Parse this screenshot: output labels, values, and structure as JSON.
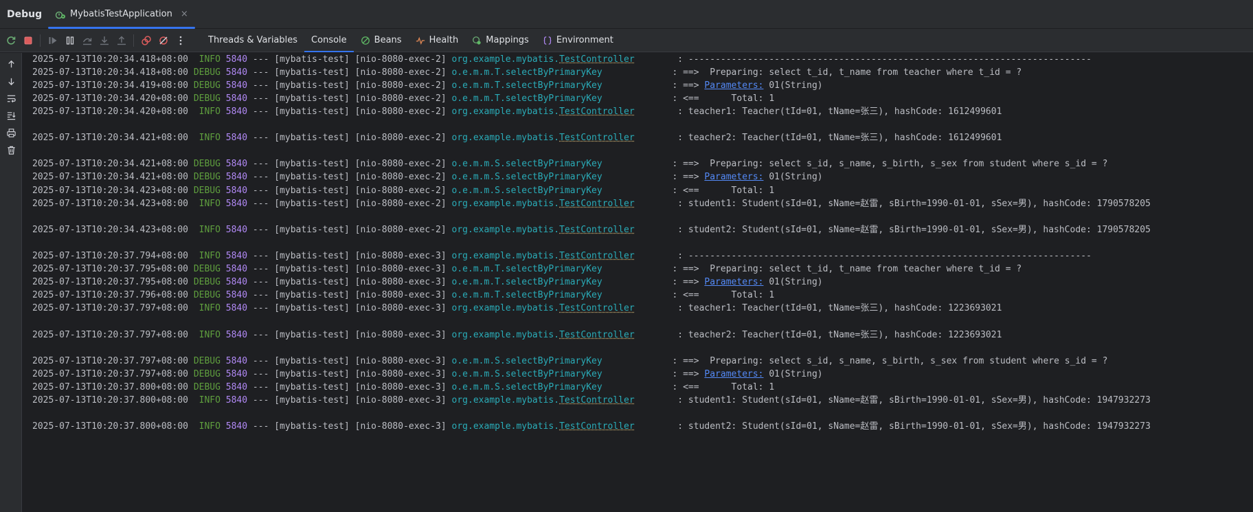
{
  "window": {
    "title": "Debug",
    "run_tab": {
      "label": "MybatisTestApplication",
      "close": "×"
    }
  },
  "toolbar": {
    "buttons": [
      {
        "name": "rerun-icon",
        "color": "#6aab73"
      },
      {
        "name": "stop-icon",
        "color": "#db5c5c"
      },
      {
        "name": "resume-icon",
        "color": "#6f737a"
      },
      {
        "name": "pause-icon",
        "color": "#ced0d6"
      },
      {
        "name": "step-over-icon",
        "color": "#6f737a"
      },
      {
        "name": "step-into-icon",
        "color": "#6f737a"
      },
      {
        "name": "step-out-icon",
        "color": "#6f737a"
      },
      {
        "name": "view-breakpoints-icon",
        "color": "#db5c5c"
      },
      {
        "name": "mute-breakpoints-icon",
        "color": "#db5c5c"
      },
      {
        "name": "more-icon",
        "color": "#ced0d6"
      }
    ],
    "tabs": [
      {
        "label": "Threads & Variables",
        "icon": "",
        "active": false
      },
      {
        "label": "Console",
        "icon": "",
        "active": true
      },
      {
        "label": "Beans",
        "icon": "beans-icon",
        "active": false
      },
      {
        "label": "Health",
        "icon": "health-icon",
        "active": false
      },
      {
        "label": "Mappings",
        "icon": "mappings-icon",
        "active": false
      },
      {
        "label": "Environment",
        "icon": "environment-icon",
        "active": false
      }
    ]
  },
  "sidebar": {
    "buttons": [
      "scroll-up-icon",
      "scroll-down-icon",
      "soft-wrap-icon",
      "scroll-to-end-icon",
      "print-icon",
      "clear-all-icon"
    ]
  },
  "colors": {
    "accent": "#3574f0",
    "level": "#5f9f3e",
    "pid": "#b189f5",
    "logger": "#2aacb8",
    "link": "#548af7"
  },
  "console": {
    "lines": [
      {
        "ts": "2025-07-13T10:20:34.418+08:00",
        "level": " INFO",
        "pid": "5840",
        "sep": "---",
        "app": "[mybatis-test]",
        "thread": "[nio-8080-exec-2]",
        "logger_prefix": "org.example.mybatis.",
        "logger_link": "TestController",
        "logger_plain": "",
        "pad": "       ",
        "msg_pre": ": ---------------------------------------------------------------------------",
        "msg_link": "",
        "msg_post": ""
      },
      {
        "ts": "2025-07-13T10:20:34.418+08:00",
        "level": "DEBUG",
        "pid": "5840",
        "sep": "---",
        "app": "[mybatis-test]",
        "thread": "[nio-8080-exec-2]",
        "logger_prefix": "",
        "logger_link": "",
        "logger_plain": "o.e.m.m.T.selectByPrimaryKey",
        "pad": "            ",
        "msg_pre": ": ==>  Preparing: select t_id, t_name from teacher where t_id = ?",
        "msg_link": "",
        "msg_post": ""
      },
      {
        "ts": "2025-07-13T10:20:34.419+08:00",
        "level": "DEBUG",
        "pid": "5840",
        "sep": "---",
        "app": "[mybatis-test]",
        "thread": "[nio-8080-exec-2]",
        "logger_prefix": "",
        "logger_link": "",
        "logger_plain": "o.e.m.m.T.selectByPrimaryKey",
        "pad": "            ",
        "msg_pre": ": ==> ",
        "msg_link": "Parameters:",
        "msg_post": " 01(String)"
      },
      {
        "ts": "2025-07-13T10:20:34.420+08:00",
        "level": "DEBUG",
        "pid": "5840",
        "sep": "---",
        "app": "[mybatis-test]",
        "thread": "[nio-8080-exec-2]",
        "logger_prefix": "",
        "logger_link": "",
        "logger_plain": "o.e.m.m.T.selectByPrimaryKey",
        "pad": "            ",
        "msg_pre": ": <==      Total: 1",
        "msg_link": "",
        "msg_post": ""
      },
      {
        "ts": "2025-07-13T10:20:34.420+08:00",
        "level": " INFO",
        "pid": "5840",
        "sep": "---",
        "app": "[mybatis-test]",
        "thread": "[nio-8080-exec-2]",
        "logger_prefix": "org.example.mybatis.",
        "logger_link": "TestController",
        "logger_plain": "",
        "pad": "       ",
        "msg_pre": ": teacher1: Teacher(tId=01, tName=张三), hashCode: 1612499601",
        "msg_link": "",
        "msg_post": ""
      },
      {
        "blank": true
      },
      {
        "ts": "2025-07-13T10:20:34.421+08:00",
        "level": " INFO",
        "pid": "5840",
        "sep": "---",
        "app": "[mybatis-test]",
        "thread": "[nio-8080-exec-2]",
        "logger_prefix": "org.example.mybatis.",
        "logger_link": "TestController",
        "logger_plain": "",
        "pad": "       ",
        "msg_pre": ": teacher2: Teacher(tId=01, tName=张三), hashCode: 1612499601",
        "msg_link": "",
        "msg_post": ""
      },
      {
        "blank": true
      },
      {
        "ts": "2025-07-13T10:20:34.421+08:00",
        "level": "DEBUG",
        "pid": "5840",
        "sep": "---",
        "app": "[mybatis-test]",
        "thread": "[nio-8080-exec-2]",
        "logger_prefix": "",
        "logger_link": "",
        "logger_plain": "o.e.m.m.S.selectByPrimaryKey",
        "pad": "            ",
        "msg_pre": ": ==>  Preparing: select s_id, s_name, s_birth, s_sex from student where s_id = ?",
        "msg_link": "",
        "msg_post": ""
      },
      {
        "ts": "2025-07-13T10:20:34.421+08:00",
        "level": "DEBUG",
        "pid": "5840",
        "sep": "---",
        "app": "[mybatis-test]",
        "thread": "[nio-8080-exec-2]",
        "logger_prefix": "",
        "logger_link": "",
        "logger_plain": "o.e.m.m.S.selectByPrimaryKey",
        "pad": "            ",
        "msg_pre": ": ==> ",
        "msg_link": "Parameters:",
        "msg_post": " 01(String)"
      },
      {
        "ts": "2025-07-13T10:20:34.423+08:00",
        "level": "DEBUG",
        "pid": "5840",
        "sep": "---",
        "app": "[mybatis-test]",
        "thread": "[nio-8080-exec-2]",
        "logger_prefix": "",
        "logger_link": "",
        "logger_plain": "o.e.m.m.S.selectByPrimaryKey",
        "pad": "            ",
        "msg_pre": ": <==      Total: 1",
        "msg_link": "",
        "msg_post": ""
      },
      {
        "ts": "2025-07-13T10:20:34.423+08:00",
        "level": " INFO",
        "pid": "5840",
        "sep": "---",
        "app": "[mybatis-test]",
        "thread": "[nio-8080-exec-2]",
        "logger_prefix": "org.example.mybatis.",
        "logger_link": "TestController",
        "logger_plain": "",
        "pad": "       ",
        "msg_pre": ": student1: Student(sId=01, sName=赵雷, sBirth=1990-01-01, sSex=男), hashCode: 1790578205",
        "msg_link": "",
        "msg_post": ""
      },
      {
        "blank": true
      },
      {
        "ts": "2025-07-13T10:20:34.423+08:00",
        "level": " INFO",
        "pid": "5840",
        "sep": "---",
        "app": "[mybatis-test]",
        "thread": "[nio-8080-exec-2]",
        "logger_prefix": "org.example.mybatis.",
        "logger_link": "TestController",
        "logger_plain": "",
        "pad": "       ",
        "msg_pre": ": student2: Student(sId=01, sName=赵雷, sBirth=1990-01-01, sSex=男), hashCode: 1790578205",
        "msg_link": "",
        "msg_post": ""
      },
      {
        "blank": true
      },
      {
        "ts": "2025-07-13T10:20:37.794+08:00",
        "level": " INFO",
        "pid": "5840",
        "sep": "---",
        "app": "[mybatis-test]",
        "thread": "[nio-8080-exec-3]",
        "logger_prefix": "org.example.mybatis.",
        "logger_link": "TestController",
        "logger_plain": "",
        "pad": "       ",
        "msg_pre": ": ---------------------------------------------------------------------------",
        "msg_link": "",
        "msg_post": ""
      },
      {
        "ts": "2025-07-13T10:20:37.795+08:00",
        "level": "DEBUG",
        "pid": "5840",
        "sep": "---",
        "app": "[mybatis-test]",
        "thread": "[nio-8080-exec-3]",
        "logger_prefix": "",
        "logger_link": "",
        "logger_plain": "o.e.m.m.T.selectByPrimaryKey",
        "pad": "            ",
        "msg_pre": ": ==>  Preparing: select t_id, t_name from teacher where t_id = ?",
        "msg_link": "",
        "msg_post": ""
      },
      {
        "ts": "2025-07-13T10:20:37.795+08:00",
        "level": "DEBUG",
        "pid": "5840",
        "sep": "---",
        "app": "[mybatis-test]",
        "thread": "[nio-8080-exec-3]",
        "logger_prefix": "",
        "logger_link": "",
        "logger_plain": "o.e.m.m.T.selectByPrimaryKey",
        "pad": "            ",
        "msg_pre": ": ==> ",
        "msg_link": "Parameters:",
        "msg_post": " 01(String)"
      },
      {
        "ts": "2025-07-13T10:20:37.796+08:00",
        "level": "DEBUG",
        "pid": "5840",
        "sep": "---",
        "app": "[mybatis-test]",
        "thread": "[nio-8080-exec-3]",
        "logger_prefix": "",
        "logger_link": "",
        "logger_plain": "o.e.m.m.T.selectByPrimaryKey",
        "pad": "            ",
        "msg_pre": ": <==      Total: 1",
        "msg_link": "",
        "msg_post": ""
      },
      {
        "ts": "2025-07-13T10:20:37.797+08:00",
        "level": " INFO",
        "pid": "5840",
        "sep": "---",
        "app": "[mybatis-test]",
        "thread": "[nio-8080-exec-3]",
        "logger_prefix": "org.example.mybatis.",
        "logger_link": "TestController",
        "logger_plain": "",
        "pad": "       ",
        "msg_pre": ": teacher1: Teacher(tId=01, tName=张三), hashCode: 1223693021",
        "msg_link": "",
        "msg_post": ""
      },
      {
        "blank": true
      },
      {
        "ts": "2025-07-13T10:20:37.797+08:00",
        "level": " INFO",
        "pid": "5840",
        "sep": "---",
        "app": "[mybatis-test]",
        "thread": "[nio-8080-exec-3]",
        "logger_prefix": "org.example.mybatis.",
        "logger_link": "TestController",
        "logger_plain": "",
        "pad": "       ",
        "msg_pre": ": teacher2: Teacher(tId=01, tName=张三), hashCode: 1223693021",
        "msg_link": "",
        "msg_post": ""
      },
      {
        "blank": true
      },
      {
        "ts": "2025-07-13T10:20:37.797+08:00",
        "level": "DEBUG",
        "pid": "5840",
        "sep": "---",
        "app": "[mybatis-test]",
        "thread": "[nio-8080-exec-3]",
        "logger_prefix": "",
        "logger_link": "",
        "logger_plain": "o.e.m.m.S.selectByPrimaryKey",
        "pad": "            ",
        "msg_pre": ": ==>  Preparing: select s_id, s_name, s_birth, s_sex from student where s_id = ?",
        "msg_link": "",
        "msg_post": ""
      },
      {
        "ts": "2025-07-13T10:20:37.797+08:00",
        "level": "DEBUG",
        "pid": "5840",
        "sep": "---",
        "app": "[mybatis-test]",
        "thread": "[nio-8080-exec-3]",
        "logger_prefix": "",
        "logger_link": "",
        "logger_plain": "o.e.m.m.S.selectByPrimaryKey",
        "pad": "            ",
        "msg_pre": ": ==> ",
        "msg_link": "Parameters:",
        "msg_post": " 01(String)"
      },
      {
        "ts": "2025-07-13T10:20:37.800+08:00",
        "level": "DEBUG",
        "pid": "5840",
        "sep": "---",
        "app": "[mybatis-test]",
        "thread": "[nio-8080-exec-3]",
        "logger_prefix": "",
        "logger_link": "",
        "logger_plain": "o.e.m.m.S.selectByPrimaryKey",
        "pad": "            ",
        "msg_pre": ": <==      Total: 1",
        "msg_link": "",
        "msg_post": ""
      },
      {
        "ts": "2025-07-13T10:20:37.800+08:00",
        "level": " INFO",
        "pid": "5840",
        "sep": "---",
        "app": "[mybatis-test]",
        "thread": "[nio-8080-exec-3]",
        "logger_prefix": "org.example.mybatis.",
        "logger_link": "TestController",
        "logger_plain": "",
        "pad": "       ",
        "msg_pre": ": student1: Student(sId=01, sName=赵雷, sBirth=1990-01-01, sSex=男), hashCode: 1947932273",
        "msg_link": "",
        "msg_post": ""
      },
      {
        "blank": true
      },
      {
        "ts": "2025-07-13T10:20:37.800+08:00",
        "level": " INFO",
        "pid": "5840",
        "sep": "---",
        "app": "[mybatis-test]",
        "thread": "[nio-8080-exec-3]",
        "logger_prefix": "org.example.mybatis.",
        "logger_link": "TestController",
        "logger_plain": "",
        "pad": "       ",
        "msg_pre": ": student2: Student(sId=01, sName=赵雷, sBirth=1990-01-01, sSex=男), hashCode: 1947932273",
        "msg_link": "",
        "msg_post": ""
      }
    ]
  }
}
